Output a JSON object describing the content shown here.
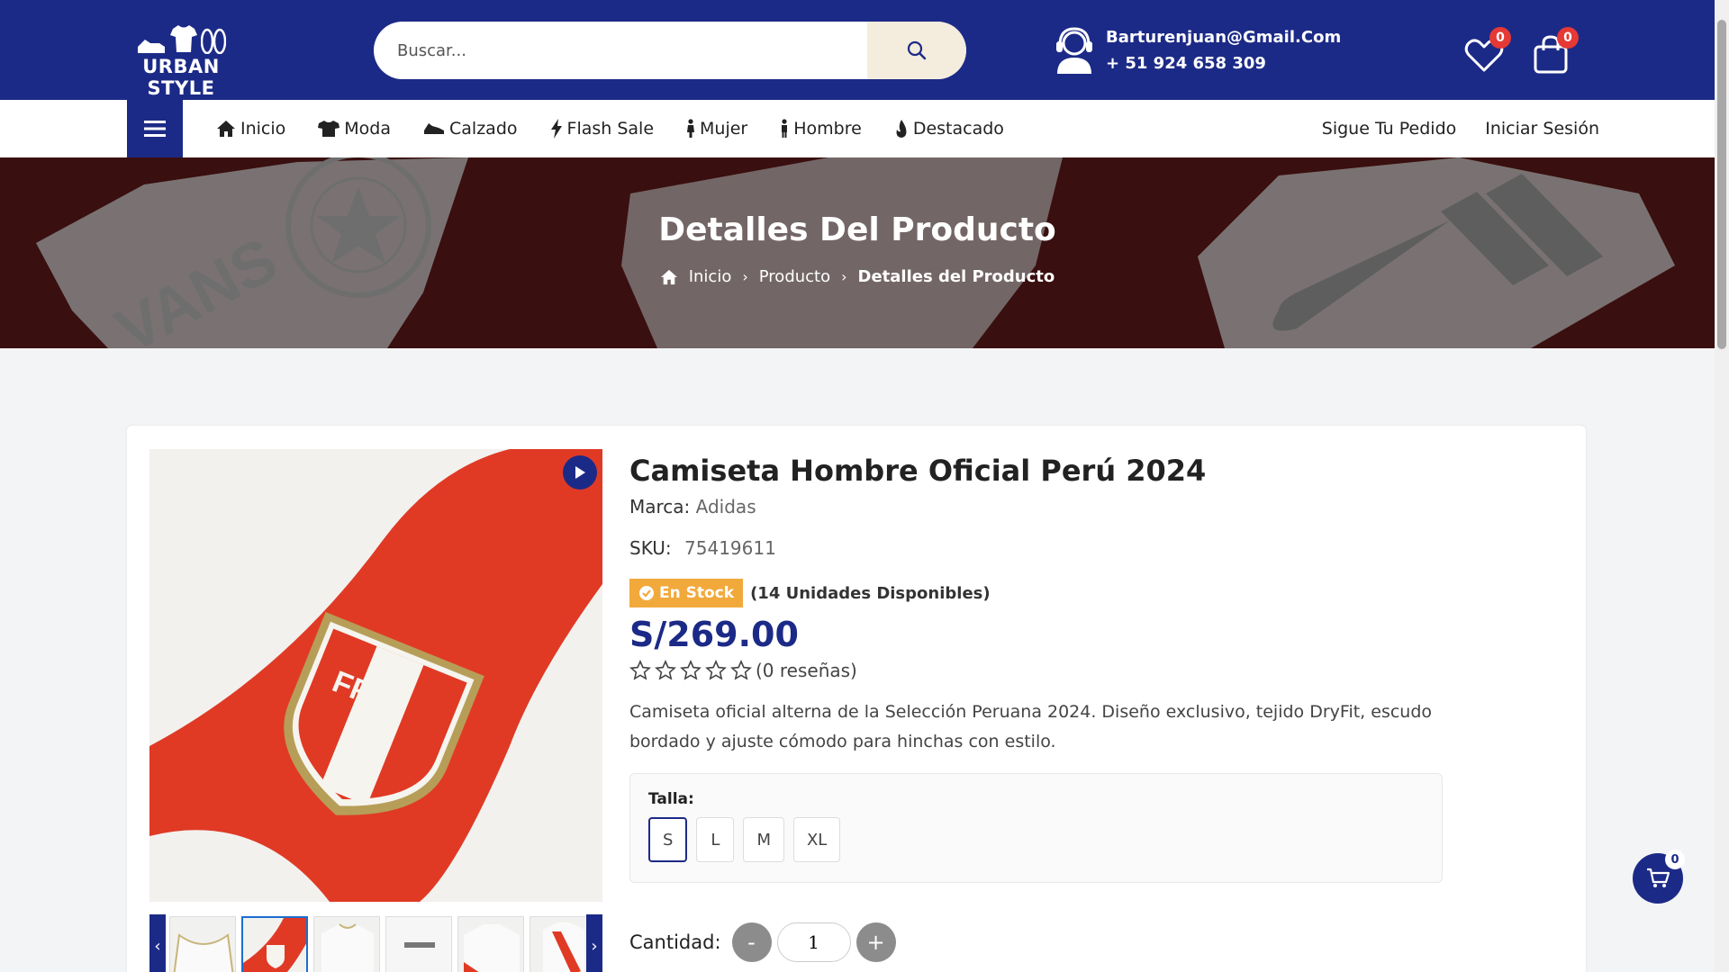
{
  "header": {
    "logo_text": "URBAN STYLE",
    "search_placeholder": "Buscar...",
    "email": "Barturenjuan@Gmail.Com",
    "phone": "+ 51 924 658 309",
    "wishlist_count": "0",
    "cart_count": "0",
    "icons": [
      "search-icon",
      "support-icon",
      "heart-icon",
      "bag-icon"
    ]
  },
  "nav": {
    "items": [
      {
        "label": "Inicio",
        "icon": "home-icon"
      },
      {
        "label": "Moda",
        "icon": "tshirt-icon"
      },
      {
        "label": "Calzado",
        "icon": "shoe-icon"
      },
      {
        "label": "Flash Sale",
        "icon": "bolt-icon"
      },
      {
        "label": "Mujer",
        "icon": "female-icon"
      },
      {
        "label": "Hombre",
        "icon": "male-icon"
      },
      {
        "label": "Destacado",
        "icon": "flame-icon"
      }
    ],
    "track_order": "Sigue Tu Pedido",
    "login": "Iniciar Sesión"
  },
  "banner": {
    "title": "Detalles Del Producto",
    "breadcrumb": [
      "Inicio",
      "Producto",
      "Detalles del Producto"
    ],
    "background_brands": [
      "VANS",
      "CONVERSE ALL STAR"
    ]
  },
  "product": {
    "title": "Camiseta Hombre Oficial Perú 2024",
    "brand_label": "Marca:",
    "brand": "Adidas",
    "sku_label": "SKU:",
    "sku": "75419611",
    "stock_badge": "En Stock",
    "stock_units": "(14 Unidades Disponibles)",
    "price": "S/269.00",
    "rating_value": 0,
    "reviews": "(0 reseñas)",
    "description": "Camiseta oficial alterna de la Selección Peruana 2024. Diseño exclusivo, tejido DryFit, escudo bordado y ajuste cómodo para hinchas con estilo.",
    "crest_text": "FPF",
    "size_label": "Talla:",
    "sizes": [
      "S",
      "L",
      "M",
      "XL"
    ],
    "selected_size": "S",
    "quantity_label": "Cantidad:",
    "quantity": "1",
    "minus": "-",
    "plus": "+"
  },
  "floating_cart": {
    "count": "0"
  },
  "colors": {
    "brand_blue": "#1c2a87",
    "stock_orange": "#f2a93b",
    "badge_red": "#e53935",
    "banner_bg": "#3a0f0f"
  }
}
